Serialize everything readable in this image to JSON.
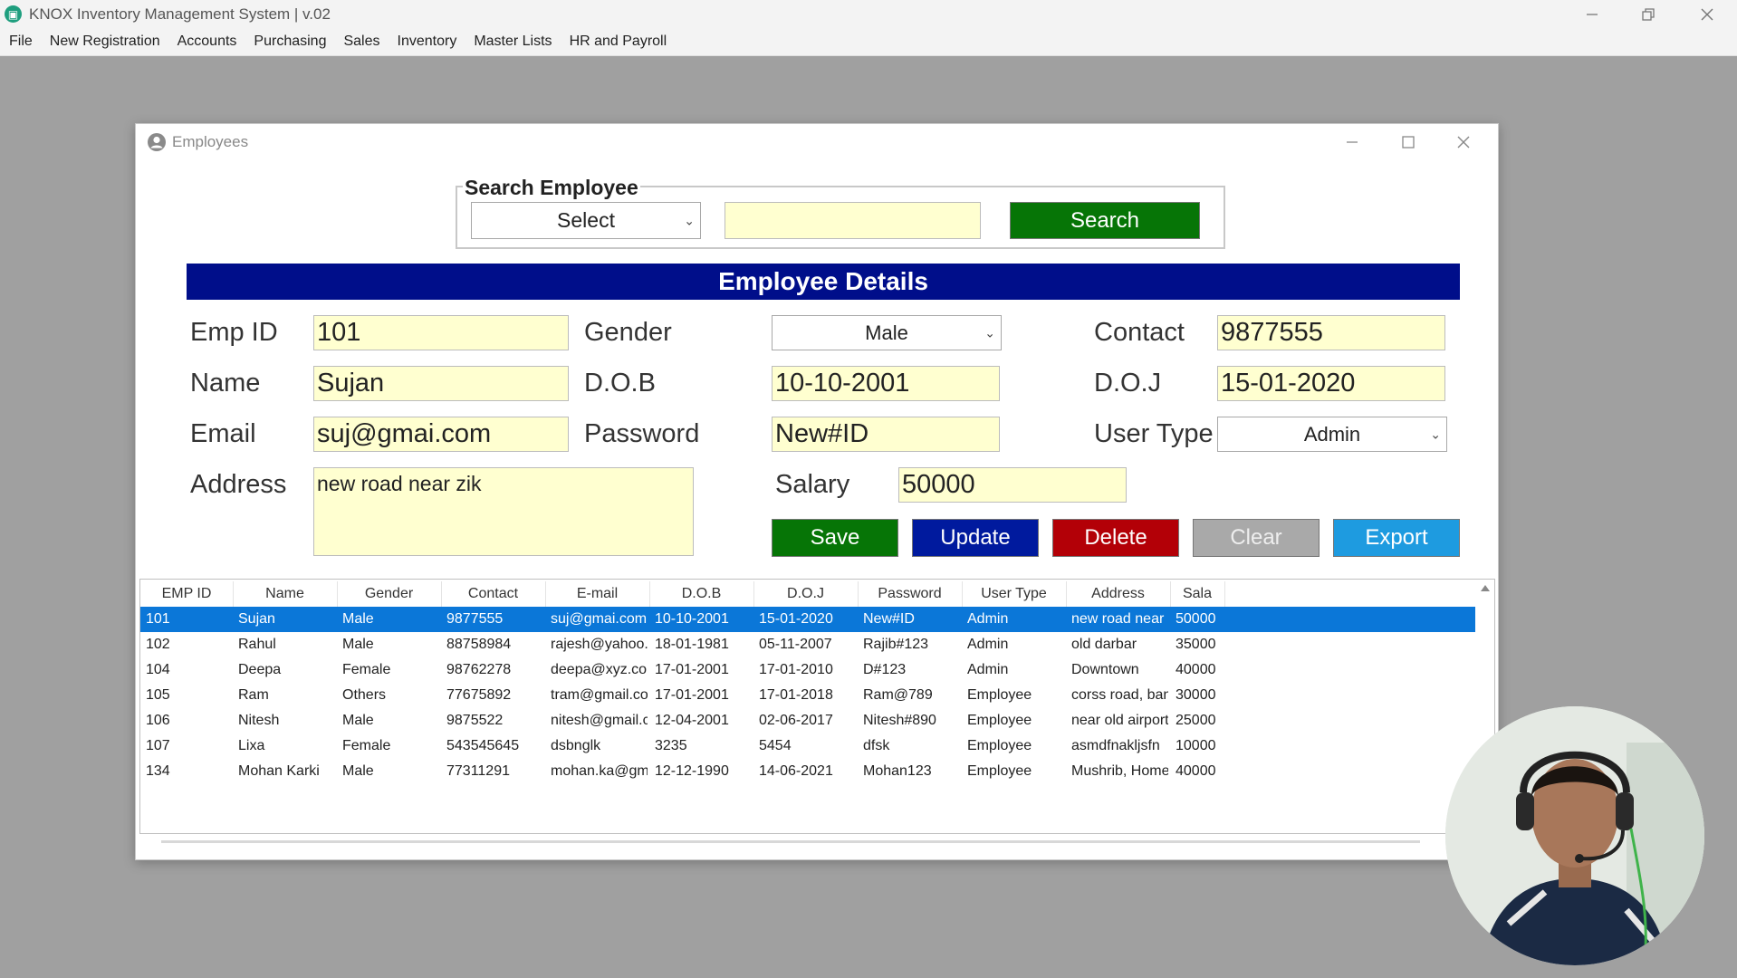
{
  "app": {
    "title": "KNOX Inventory Management System | v.02",
    "menu": [
      "File",
      "New Registration",
      "Accounts",
      "Purchasing",
      "Sales",
      "Inventory",
      "Master Lists",
      "HR and Payroll"
    ]
  },
  "employees_window": {
    "title": "Employees",
    "search": {
      "legend": "Search Employee",
      "select_value": "Select",
      "text_value": "",
      "button": "Search"
    },
    "banner": "Employee Details",
    "form": {
      "emp_id": {
        "label": "Emp ID",
        "value": "101"
      },
      "name": {
        "label": "Name",
        "value": "Sujan"
      },
      "email": {
        "label": "Email",
        "value": "suj@gmai.com"
      },
      "address": {
        "label": "Address",
        "value": "new road near zik"
      },
      "gender": {
        "label": "Gender",
        "value": "Male"
      },
      "dob": {
        "label": "D.O.B",
        "value": "10-10-2001"
      },
      "password": {
        "label": "Password",
        "value": "New#ID"
      },
      "salary": {
        "label": "Salary",
        "value": "50000"
      },
      "contact": {
        "label": "Contact",
        "value": "9877555"
      },
      "doj": {
        "label": "D.O.J",
        "value": "15-01-2020"
      },
      "user_type": {
        "label": "User Type",
        "value": "Admin"
      }
    },
    "buttons": {
      "save": "Save",
      "update": "Update",
      "delete": "Delete",
      "clear": "Clear",
      "export": "Export"
    },
    "table": {
      "headers": [
        "EMP ID",
        "Name",
        "Gender",
        "Contact",
        "E-mail",
        "D.O.B",
        "D.O.J",
        "Password",
        "User Type",
        "Address",
        "Sala"
      ],
      "rows": [
        [
          "101",
          "Sujan",
          "Male",
          "9877555",
          "suj@gmai.com",
          "10-10-2001",
          "15-01-2020",
          "New#ID",
          "Admin",
          "new road near zik",
          "50000"
        ],
        [
          "102",
          "Rahul",
          "Male",
          "88758984",
          "rajesh@yahoo.co",
          "18-01-1981",
          "05-11-2007",
          "Rajib#123",
          "Admin",
          "old darbar",
          "35000"
        ],
        [
          "104",
          "Deepa",
          "Female",
          "98762278",
          "deepa@xyz.com",
          "17-01-2001",
          "17-01-2010",
          "D#123",
          "Admin",
          "Downtown",
          "40000"
        ],
        [
          "105",
          "Ram",
          "Others",
          "77675892",
          "tram@gmail.com",
          "17-01-2001",
          "17-01-2018",
          "Ram@789",
          "Employee",
          "corss road, banep",
          "30000"
        ],
        [
          "106",
          "Nitesh",
          "Male",
          "9875522",
          "nitesh@gmail.cor",
          "12-04-2001",
          "02-06-2017",
          "Nitesh#890",
          "Employee",
          "near old airport",
          "25000"
        ],
        [
          "107",
          "Lixa",
          "Female",
          "543545645",
          "dsbnglk",
          "3235",
          "5454",
          "dfsk",
          "Employee",
          "asmdfnakljsfn",
          "10000"
        ],
        [
          "134",
          "Mohan Karki",
          "Male",
          "77311291",
          "mohan.ka@gmai",
          "12-12-1990",
          "14-06-2021",
          "Mohan123",
          "Employee",
          "Mushrib, Home C",
          "40000"
        ]
      ],
      "selected_row": 0
    }
  },
  "colors": {
    "banner": "#000e8a",
    "save": "#067506",
    "update": "#001a9e",
    "delete": "#b30007",
    "clear": "#a9a9a9",
    "export": "#1e9be0",
    "field_bg": "#ffffd0",
    "selection": "#0b77d8"
  }
}
